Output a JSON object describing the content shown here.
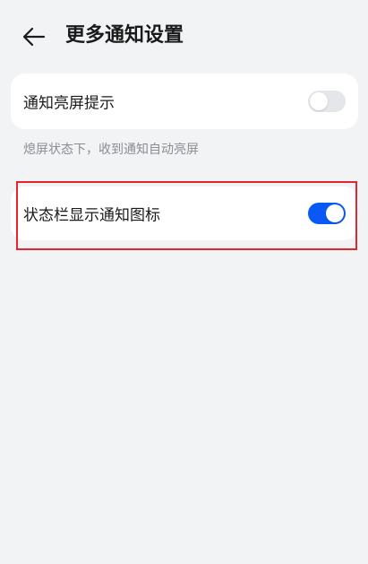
{
  "header": {
    "title": "更多通知设置",
    "back_icon": "arrow-left-icon"
  },
  "settings": [
    {
      "label": "通知亮屏提示",
      "enabled": false,
      "description": "熄屏状态下，收到通知自动亮屏"
    },
    {
      "label": "状态栏显示通知图标",
      "enabled": true
    }
  ],
  "colors": {
    "toggle_on": "#0a59f7",
    "toggle_off": "#e5e6e9",
    "highlight": "#e6262e",
    "background": "#f1f3f5"
  }
}
